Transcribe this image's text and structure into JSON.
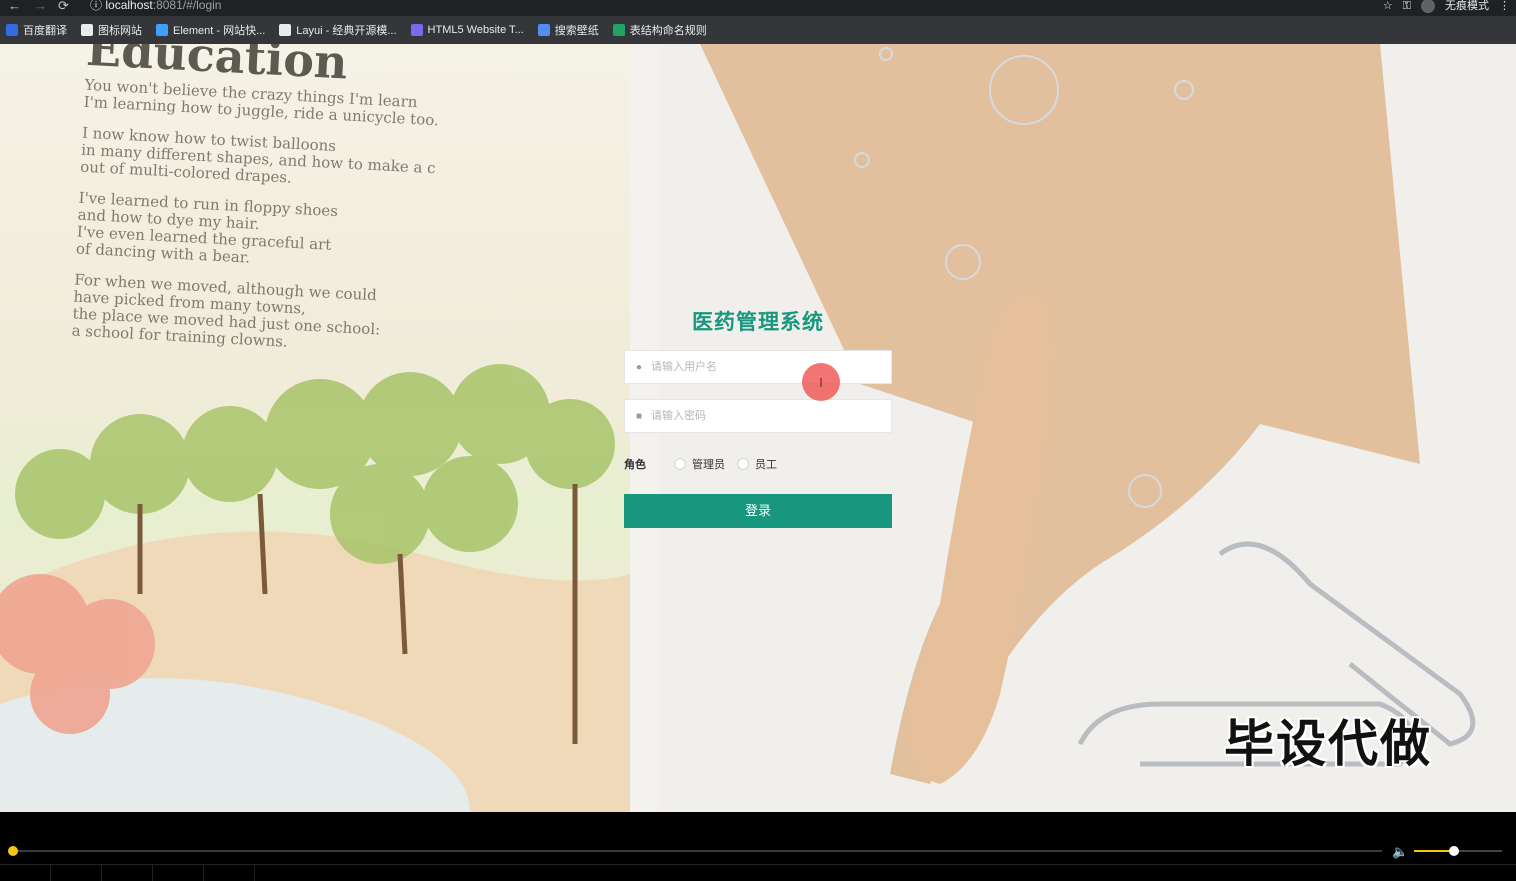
{
  "browser": {
    "url_host": "localhost",
    "url_path": ":8081/#/login",
    "incognito_label": "无痕模式"
  },
  "bookmarks": [
    {
      "label": "百度翻译",
      "icon": "translate-icon",
      "color": "#2f6de1"
    },
    {
      "label": "图标网站",
      "icon": "flag-icon",
      "color": "#e8eaed"
    },
    {
      "label": "Element - 网站快...",
      "icon": "element-icon",
      "color": "#409eff"
    },
    {
      "label": "Layui - 经典开源模...",
      "icon": "layui-icon",
      "color": "#e8eaed"
    },
    {
      "label": "HTML5 Website T...",
      "icon": "html5-icon",
      "color": "#7b68ee"
    },
    {
      "label": "搜索壁纸",
      "icon": "wallpaper-icon",
      "color": "#4f8ef7"
    },
    {
      "label": "表结构命名规则",
      "icon": "sheet-icon",
      "color": "#1fa463"
    }
  ],
  "book": {
    "heading": "Education",
    "paragraphs": [
      [
        "You won't believe the crazy things I'm learn",
        "I'm learning how to juggle, ride a unicycle too."
      ],
      [
        "I now know how to twist balloons",
        "in many different shapes, and how to make a c",
        "out of multi-colored drapes."
      ],
      [
        "I've learned to run in floppy shoes",
        "and how to dye my hair.",
        "I've even learned the graceful art",
        "of dancing with a bear."
      ],
      [
        "For when we moved, although we could",
        "have picked from many towns,",
        "the place we moved had just one school:",
        "a school for training clowns."
      ]
    ]
  },
  "login": {
    "title": "医药管理系统",
    "username_placeholder": "请输入用户名",
    "password_placeholder": "请输入密码",
    "role_label": "角色",
    "role_options": [
      "管理员",
      "员工"
    ],
    "submit_label": "登录"
  },
  "watermark": "毕设代做",
  "player": {
    "progress": 0.0,
    "volume": 0.45
  },
  "colors": {
    "accent": "#17977e",
    "cursor": "#ef5350",
    "progress": "#f5c518"
  }
}
